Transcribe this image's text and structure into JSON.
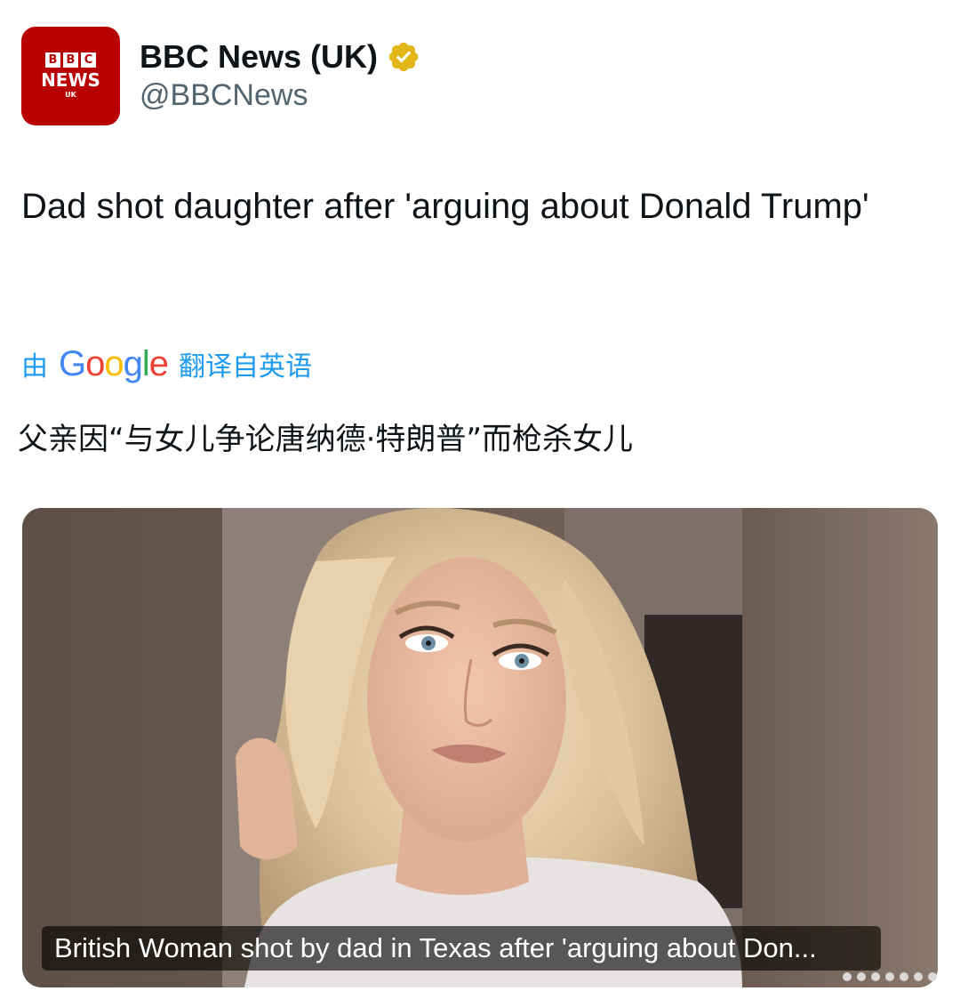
{
  "account": {
    "avatar": {
      "letters": [
        "B",
        "B",
        "C"
      ],
      "label": "NEWS",
      "region": "UK"
    },
    "display_name": "BBC News (UK)",
    "handle": "@BBCNews",
    "verified_icon": "verified-gold-badge-icon"
  },
  "tweet": {
    "text": "Dad shot daughter after 'arguing about Donald Trump'"
  },
  "translation": {
    "prefix": "由",
    "provider_letters": [
      "G",
      "o",
      "o",
      "g",
      "l",
      "e"
    ],
    "suffix": "翻译自英语",
    "text": "父亲因“与女儿争论唐纳德·特朗普”而枪杀女儿"
  },
  "media": {
    "caption": "British Woman shot by dad in Texas after 'arguing about Don..."
  },
  "colors": {
    "brand_red": "#b80000",
    "verified_gold": "#e2b719",
    "link_blue": "#1d9bf0",
    "handle_gray": "#536471",
    "google_blue": "#4285f4",
    "google_red": "#ea4335",
    "google_yellow": "#fbbc05",
    "google_green": "#34a853"
  }
}
